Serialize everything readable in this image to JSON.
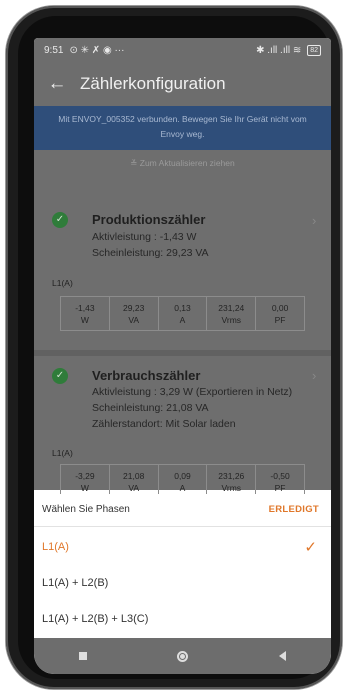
{
  "status_bar": {
    "time": "9:51",
    "left_icons": "⊙ ✳ ✗ ◉ ···",
    "right_icons": "✱ .ıll .ıll ≋",
    "battery": "82"
  },
  "app_bar": {
    "title": "Zählerkonfiguration"
  },
  "banner": {
    "line1": "Mit ENVOY_005352 verbunden. Bewegen Sie Ihr Gerät nicht vom",
    "line2": "Envoy weg."
  },
  "pull_hint": "Zum Aktualisieren ziehen",
  "meters": [
    {
      "name": "Produktionszähler",
      "lines": [
        "Aktivleistung : -1,43 W",
        "Scheinleistung: 29,23 VA"
      ],
      "phase": "L1(A)",
      "values": [
        [
          "-1,43",
          "W"
        ],
        [
          "29,23",
          "VA"
        ],
        [
          "0,13",
          "A"
        ],
        [
          "231,24",
          "Vrms"
        ],
        [
          "0,00",
          "PF"
        ]
      ]
    },
    {
      "name": "Verbrauchszähler",
      "lines": [
        "Aktivleistung : 3,29 W (Exportieren in Netz)",
        "Scheinleistung: 21,08 VA",
        "Zählerstandort: Mit Solar laden"
      ],
      "phase": "L1(A)",
      "values": [
        [
          "-3,29",
          "W"
        ],
        [
          "21,08",
          "VA"
        ],
        [
          "0,09",
          "A"
        ],
        [
          "231,26",
          "Vrms"
        ],
        [
          "-0,50",
          "PF"
        ]
      ]
    }
  ],
  "sheet": {
    "title": "Wählen Sie Phasen",
    "done_label": "ERLEDIGT",
    "options": [
      "L1(A)",
      "L1(A) + L2(B)",
      "L1(A) + L2(B) + L3(C)"
    ],
    "selected_index": 0,
    "accent_color": "#e0772a"
  },
  "icons": {
    "back": "arrow-left",
    "check": "check-circle",
    "chevron": "chevron-right",
    "selected": "check-mark",
    "nav": [
      "square",
      "circle",
      "triangle-left"
    ]
  }
}
